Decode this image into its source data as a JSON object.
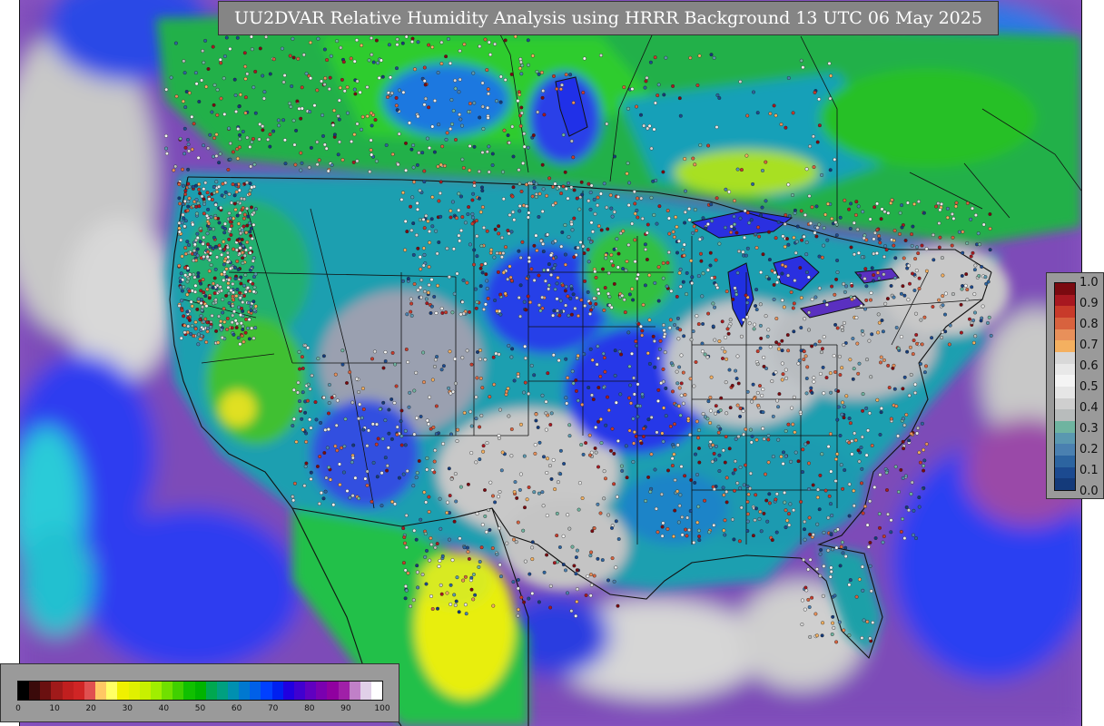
{
  "title": "UU2DVAR Relative Humidity Analysis using HRRR Background 13 UTC 06 May 2025",
  "map": {
    "region": "contiguous-united-states",
    "variable": "relative-humidity",
    "overlays": [
      "state-boundaries",
      "country-boundaries",
      "coastlines",
      "station-observations"
    ]
  },
  "rh_colorbar": {
    "ticks": [
      "0",
      "10",
      "20",
      "30",
      "40",
      "50",
      "60",
      "70",
      "80",
      "90",
      "100"
    ],
    "colors": [
      "#000000",
      "#3a0a0a",
      "#6a1010",
      "#a01a1a",
      "#c01f1f",
      "#d02525",
      "#e05050",
      "#ffc864",
      "#ffff66",
      "#f0f000",
      "#e0f000",
      "#c8f000",
      "#a0ee00",
      "#70e000",
      "#40d000",
      "#10c000",
      "#00b400",
      "#00a850",
      "#00a080",
      "#0090b0",
      "#0078d0",
      "#0060e8",
      "#0040ff",
      "#0020f0",
      "#2000e0",
      "#4000d0",
      "#6000c0",
      "#7a00b0",
      "#9000a0",
      "#a020a8",
      "#c080c8",
      "#e0d0e8",
      "#ffffff"
    ]
  },
  "qc_colorbar": {
    "ticks": [
      "1.0",
      "0.9",
      "0.8",
      "0.7",
      "0.6",
      "0.5",
      "0.4",
      "0.3",
      "0.2",
      "0.1",
      "0.0"
    ],
    "colors": [
      "#7a0a10",
      "#a81820",
      "#c83a2a",
      "#d8623e",
      "#e8905a",
      "#f4b060",
      "#d8d8d8",
      "#e8e8e8",
      "#f4f4f4",
      "#e6e6e6",
      "#cfcfcf",
      "#b8bcbc",
      "#6fb4a0",
      "#5a98b0",
      "#4a80b0",
      "#2c64a0",
      "#1c4a90",
      "#143a7a"
    ]
  },
  "palette": {
    "ocean_purple": "#8a55c2",
    "ocean_blue": "#2a50e6",
    "gray_dry": "#c8c8c8",
    "teal": "#1ea0a0",
    "green": "#22c422",
    "yellow": "#e8ee10",
    "border": "#111111"
  }
}
